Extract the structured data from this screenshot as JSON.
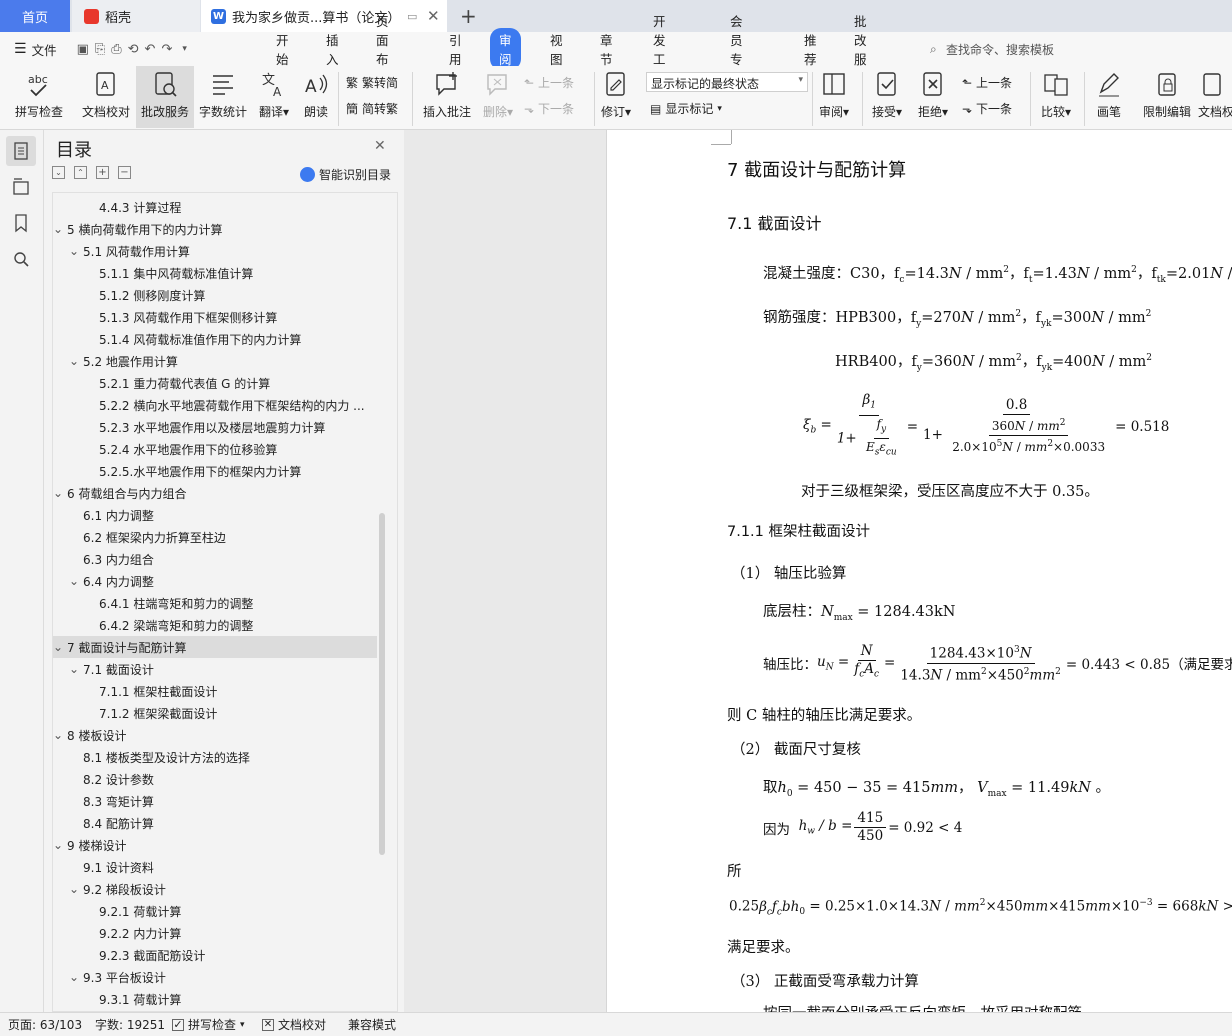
{
  "tabs": {
    "home": "首页",
    "daoke": "稻壳",
    "doc": "我为家乡做贡...算书（论文）",
    "add": "+"
  },
  "menu": {
    "file": "文件",
    "items": [
      "开始",
      "插入",
      "页面布局",
      "引用",
      "审阅",
      "视图",
      "章节",
      "开发工具",
      "会员专享",
      "推荐",
      "批改服务"
    ],
    "active": "审阅",
    "search": "查找命令、搜索模板"
  },
  "ribbon": {
    "spell": "拼写检查",
    "proof": "文档校对",
    "review_service": "批改服务",
    "word_count": "字数统计",
    "translate": "翻译",
    "read": "朗读",
    "to_trad": "繁转简",
    "to_simp": "简转繁",
    "insert_comment": "插入批注",
    "delete": "删除",
    "prev": "上一条",
    "next": "下一条",
    "track": "修订",
    "markup_select": "显示标记的最终状态",
    "show_markup": "显示标记",
    "review": "审阅",
    "accept": "接受",
    "reject": "拒绝",
    "prev2": "上一条",
    "next2": "下一条",
    "compare": "比较",
    "pen": "画笔",
    "restrict": "限制编辑",
    "doc_perm": "文档权"
  },
  "toc": {
    "title": "目录",
    "smart": "智能识别目录",
    "items": [
      {
        "level": 3,
        "text": "4.4.3 计算过程"
      },
      {
        "level": 1,
        "text": "5  横向荷载作用下的内力计算",
        "chev": true
      },
      {
        "level": 2,
        "text": "5.1 风荷载作用计算",
        "chev": true
      },
      {
        "level": 3,
        "text": "5.1.1 集中风荷载标准值计算"
      },
      {
        "level": 3,
        "text": "5.1.2 侧移刚度计算"
      },
      {
        "level": 3,
        "text": "5.1.3 风荷载作用下框架侧移计算"
      },
      {
        "level": 3,
        "text": "5.1.4 风荷载标准值作用下的内力计算"
      },
      {
        "level": 2,
        "text": "5.2 地震作用计算",
        "chev": true
      },
      {
        "level": 3,
        "text": "5.2.1 重力荷载代表值 G 的计算"
      },
      {
        "level": 3,
        "text": "5.2.2 横向水平地震荷载作用下框架结构的内力 ..."
      },
      {
        "level": 3,
        "text": "5.2.3 水平地震作用以及楼层地震剪力计算"
      },
      {
        "level": 3,
        "text": "5.2.4 水平地震作用下的位移验算"
      },
      {
        "level": 3,
        "text": "5.2.5.水平地震作用下的框架内力计算"
      },
      {
        "level": 1,
        "text": "6  荷载组合与内力组合",
        "chev": true
      },
      {
        "level": 2,
        "text": "6.1 内力调整"
      },
      {
        "level": 2,
        "text": "6.2 框架梁内力折算至柱边"
      },
      {
        "level": 2,
        "text": "6.3 内力组合"
      },
      {
        "level": 2,
        "text": "6.4 内力调整",
        "chev": true
      },
      {
        "level": 3,
        "text": "6.4.1 柱端弯矩和剪力的调整"
      },
      {
        "level": 3,
        "text": "6.4.2 梁端弯矩和剪力的调整"
      },
      {
        "level": 1,
        "text": "7  截面设计与配筋计算",
        "chev": true,
        "selected": true
      },
      {
        "level": 2,
        "text": "7.1 截面设计",
        "chev": true
      },
      {
        "level": 3,
        "text": "7.1.1 框架柱截面设计"
      },
      {
        "level": 3,
        "text": "7.1.2 框架梁截面设计"
      },
      {
        "level": 1,
        "text": "8  楼板设计",
        "chev": true
      },
      {
        "level": 2,
        "text": "8.1 楼板类型及设计方法的选择"
      },
      {
        "level": 2,
        "text": "8.2 设计参数"
      },
      {
        "level": 2,
        "text": "8.3 弯矩计算"
      },
      {
        "level": 2,
        "text": "8.4 配筋计算"
      },
      {
        "level": 1,
        "text": "9  楼梯设计",
        "chev": true
      },
      {
        "level": 2,
        "text": "9.1 设计资料"
      },
      {
        "level": 2,
        "text": "9.2 梯段板设计",
        "chev": true
      },
      {
        "level": 3,
        "text": "9.2.1 荷载计算"
      },
      {
        "level": 3,
        "text": "9.2.2 内力计算"
      },
      {
        "level": 3,
        "text": "9.2.3 截面配筋设计"
      },
      {
        "level": 2,
        "text": "9.3 平台板设计",
        "chev": true
      },
      {
        "level": 3,
        "text": "9.3.1 荷载计算"
      }
    ]
  },
  "doc": {
    "h1": "7  截面设计与配筋计算",
    "h2": "7.1 截面设计",
    "concrete_label": "混凝土强度：C30，",
    "concrete_vals": "f",
    "steel_label": "钢筋强度：HPB300，",
    "hrb": "HRB400，",
    "xi_result": "= 0.518",
    "frame_note": "对于三级框架梁，受压区高度应不大于 0.35。",
    "h3": "7.1.1 框架柱截面设计",
    "s1": "（1）  轴压比验算",
    "bottom_col": "底层柱：",
    "nmax": "= 1284.43kN",
    "axial_label": "轴压比：",
    "axial_res": "= 0.443 < 0.85（满足要求",
    "col_c": "则 C 轴柱的轴压比满足要求。",
    "s2": "（2）  截面尺寸复核",
    "take": "取",
    "because": "因为",
    "so": "所",
    "ok": "满足要求。",
    "s3": "（3）  正截面受弯承载力计算",
    "last": "按同一截面分别承受正反向弯矩，故采用对称配筋"
  },
  "status": {
    "page": "页面: 63/103",
    "words": "字数: 19251",
    "spell": "拼写检查",
    "proof": "文档校对",
    "compat": "兼容模式"
  }
}
